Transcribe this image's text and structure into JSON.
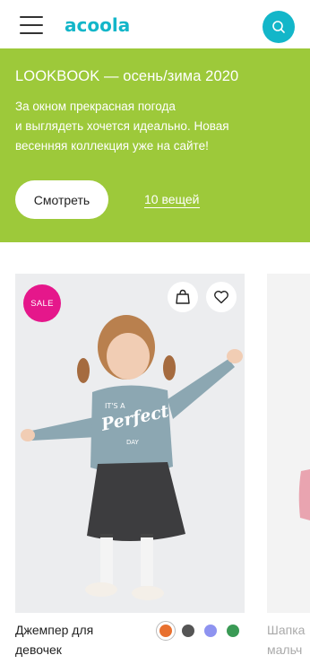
{
  "header": {
    "logo_text": "acoola",
    "brand_color": "#13b6c9",
    "menu_icon": "menu-icon",
    "search_icon": "search-icon"
  },
  "banner": {
    "title": "LOOKBOOK — осень/зима 2020",
    "text_lines": [
      "За окном прекрасная погода",
      "и выглядеть хочется идеально. Новая",
      "весенняя коллекция уже на сайте!"
    ],
    "button_label": "Смотреть",
    "link_label": "10 вещей",
    "background": "#9dc93a"
  },
  "products": [
    {
      "badge": "SALE",
      "badge_color": "#e5178b",
      "name_lines": [
        "Джемпер для",
        "девочек"
      ],
      "print_text": [
        "IT'S A",
        "Perfect",
        "DAY"
      ],
      "swatches": [
        {
          "color": "#e8702f",
          "selected": true
        },
        {
          "color": "#555555",
          "selected": false
        },
        {
          "color": "#8e93f0",
          "selected": false
        },
        {
          "color": "#3a9a55",
          "selected": false
        }
      ],
      "cart_icon": "bag-icon",
      "fav_icon": "heart-icon"
    },
    {
      "name_lines": [
        "Шапка",
        "мальч"
      ]
    }
  ]
}
